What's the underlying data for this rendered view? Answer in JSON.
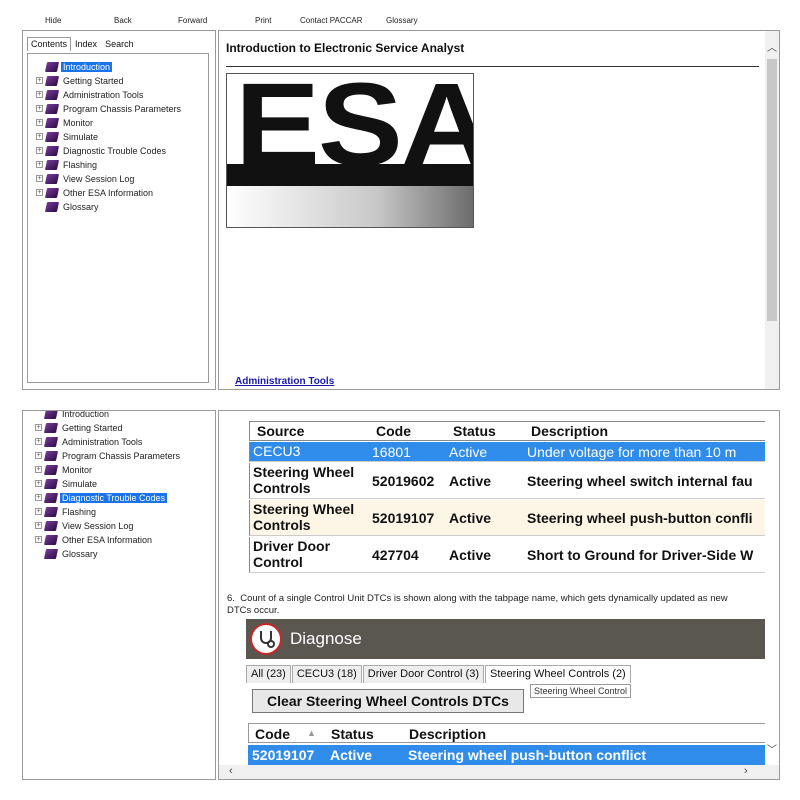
{
  "toolbar": {
    "hide": "Hide",
    "back": "Back",
    "forward": "Forward",
    "print": "Print",
    "contact": "Contact PACCAR",
    "glossary": "Glossary"
  },
  "nav_tabs": {
    "contents": "Contents",
    "index": "Index",
    "search": "Search"
  },
  "tree_top": [
    {
      "label": "Introduction",
      "expandable": false,
      "selected": true
    },
    {
      "label": "Getting Started",
      "expandable": true,
      "selected": false
    },
    {
      "label": "Administration Tools",
      "expandable": true,
      "selected": false
    },
    {
      "label": "Program Chassis Parameters",
      "expandable": true,
      "selected": false
    },
    {
      "label": "Monitor",
      "expandable": true,
      "selected": false
    },
    {
      "label": "Simulate",
      "expandable": true,
      "selected": false
    },
    {
      "label": "Diagnostic Trouble Codes",
      "expandable": true,
      "selected": false
    },
    {
      "label": "Flashing",
      "expandable": true,
      "selected": false
    },
    {
      "label": "View Session Log",
      "expandable": true,
      "selected": false
    },
    {
      "label": "Other ESA Information",
      "expandable": true,
      "selected": false
    },
    {
      "label": "Glossary",
      "expandable": false,
      "selected": false
    }
  ],
  "tree_bottom": [
    {
      "label": "Introduction",
      "expandable": false,
      "selected": false
    },
    {
      "label": "Getting Started",
      "expandable": true,
      "selected": false
    },
    {
      "label": "Administration Tools",
      "expandable": true,
      "selected": false
    },
    {
      "label": "Program Chassis Parameters",
      "expandable": true,
      "selected": false
    },
    {
      "label": "Monitor",
      "expandable": true,
      "selected": false
    },
    {
      "label": "Simulate",
      "expandable": true,
      "selected": false
    },
    {
      "label": "Diagnostic Trouble Codes",
      "expandable": true,
      "selected": true
    },
    {
      "label": "Flashing",
      "expandable": true,
      "selected": false
    },
    {
      "label": "View Session Log",
      "expandable": true,
      "selected": false
    },
    {
      "label": "Other ESA Information",
      "expandable": true,
      "selected": false
    },
    {
      "label": "Glossary",
      "expandable": false,
      "selected": false
    }
  ],
  "intro_page": {
    "title": "Introduction to Electronic Service Analyst",
    "logo_text": "ESA",
    "link": "Administration Tools"
  },
  "dtc_table": {
    "headers": [
      "Source",
      "Code",
      "Status",
      "Description"
    ],
    "rows": [
      {
        "source": "CECU3",
        "code": "16801",
        "status": "Active",
        "description": "Under voltage for more than 10 m",
        "selected": true
      },
      {
        "source": "Steering Wheel Controls",
        "code": "52019602",
        "status": "Active",
        "description": "Steering wheel switch internal fau",
        "selected": false
      },
      {
        "source": "Steering Wheel Controls",
        "code": "52019107",
        "status": "Active",
        "description": "Steering wheel push-button confli",
        "selected": false
      },
      {
        "source": "Driver Door Control",
        "code": "427704",
        "status": "Active",
        "description": "Short to Ground for Driver-Side W",
        "selected": false
      }
    ]
  },
  "note": {
    "number": "6.",
    "text": "Count of a single Control Unit DTCs is shown along with the tabpage name, which gets dynamically updated as new DTCs occur."
  },
  "diagnose": {
    "title": "Diagnose",
    "tabs": [
      "All (23)",
      "CECU3 (18)",
      "Driver Door Control (3)",
      "Steering Wheel Controls (2)"
    ],
    "active_tab": 3,
    "clear_button": "Clear Steering Wheel Controls DTCs",
    "tooltip": "Steering Wheel Control",
    "headers": [
      "Code",
      "Status",
      "Description"
    ],
    "row": {
      "code": "52019107",
      "status": "Active",
      "description": "Steering wheel push-button conflict"
    }
  },
  "colors": {
    "selection": "#2f8ceb",
    "tree_selection": "#1a73e8",
    "diagnose_bar": "#5a5650",
    "alt_row": "#fdf6e6",
    "link": "#1a1aa8"
  }
}
